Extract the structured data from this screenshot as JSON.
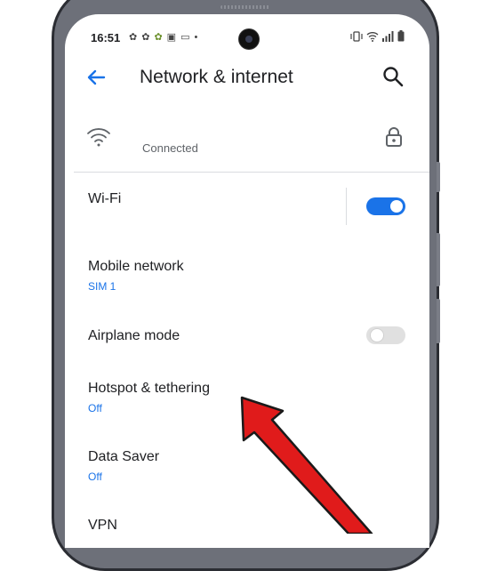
{
  "status_bar": {
    "time": "16:51"
  },
  "top_bar": {
    "title": "Network & internet"
  },
  "wifi_network": {
    "status": "Connected"
  },
  "settings": [
    {
      "title": "Wi-Fi",
      "subtitle": "",
      "toggle": "on"
    },
    {
      "title": "Mobile network",
      "subtitle": "SIM 1"
    },
    {
      "title": "Airplane mode",
      "subtitle": "",
      "toggle": "off"
    },
    {
      "title": "Hotspot & tethering",
      "subtitle": "Off"
    },
    {
      "title": "Data Saver",
      "subtitle": "Off"
    },
    {
      "title": "VPN",
      "subtitle": ""
    }
  ],
  "colors": {
    "accent": "#1a73e8",
    "toggle_on_track": "#1a73e8",
    "toggle_off_track": "#e0e0e0",
    "annotation_arrow": "#e01b1b"
  }
}
